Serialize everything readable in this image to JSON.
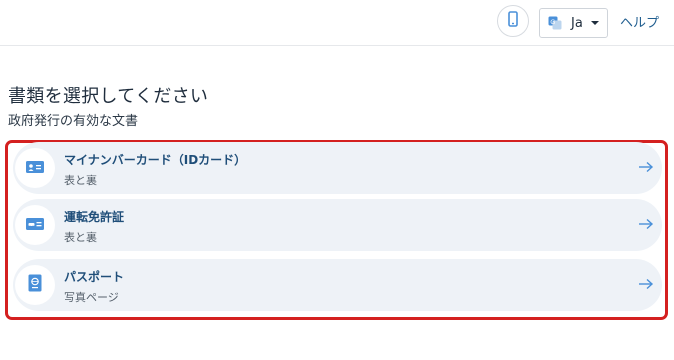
{
  "header": {
    "language_label": "Ja",
    "help_label": "ヘルプ"
  },
  "main": {
    "title": "書類を選択してください",
    "subtitle": "政府発行の有効な文書",
    "options": [
      {
        "title": "マイナンバーカード（IDカード）",
        "subtitle": "表と裏",
        "icon": "id-card-icon"
      },
      {
        "title": "運転免許証",
        "subtitle": "表と裏",
        "icon": "driver-license-icon"
      },
      {
        "title": "パスポート",
        "subtitle": "写真ページ",
        "icon": "passport-icon"
      }
    ]
  },
  "colors": {
    "accent": "#1f4e79",
    "icon_blue": "#4a90d9",
    "row_bg": "#eef2f7",
    "highlight_frame": "#d42020"
  }
}
